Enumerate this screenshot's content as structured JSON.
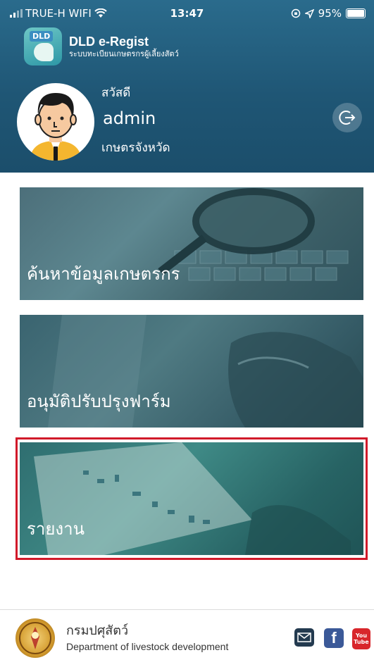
{
  "status_bar": {
    "carrier": "TRUE-H WIFI",
    "time": "13:47",
    "battery": "95%"
  },
  "app": {
    "logo_text": "DLD",
    "title": "DLD e-Regist",
    "subtitle": "ระบบทะเบียนเกษตรกรผู้เลี้ยงสัตว์"
  },
  "user": {
    "greeting": "สวัสดี",
    "name": "admin",
    "role": "เกษตรจังหวัด"
  },
  "menu": {
    "items": [
      {
        "label": "ค้นหาข้อมูลเกษตรกร",
        "icon": "magnifier-keyboard-photo"
      },
      {
        "label": "อนุมัติปรับปรุงฟาร์ม",
        "icon": "hands-typing-photo"
      },
      {
        "label": "รายงาน",
        "icon": "report-charts-photo"
      }
    ],
    "highlight_color": "#d11a2a"
  },
  "footer": {
    "dept_th": "กรมปศุสัตว์",
    "dept_en": "Department of livestock development",
    "youtube_top": "You",
    "youtube_bottom": "Tube"
  },
  "colors": {
    "header": "#1f5675",
    "accent_red": "#d11a2a"
  }
}
